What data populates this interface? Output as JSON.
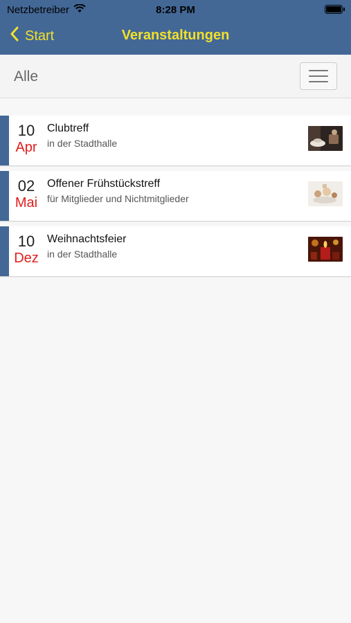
{
  "status": {
    "carrier": "Netzbetreiber",
    "time": "8:28 PM"
  },
  "nav": {
    "back_label": "Start",
    "title": "Veranstaltungen"
  },
  "filter": {
    "label": "Alle"
  },
  "events": [
    {
      "day": "10",
      "month": "Apr",
      "title": "Clubtreff",
      "subtitle": "in der Stadthalle"
    },
    {
      "day": "02",
      "month": "Mai",
      "title": "Offener Frühstückstreff",
      "subtitle": "für Mitglieder und Nichtmitglieder"
    },
    {
      "day": "10",
      "month": "Dez",
      "title": "Weihnachtsfeier",
      "subtitle": "in der Stadthalle"
    }
  ],
  "colors": {
    "header": "#436896",
    "accent": "#f2e02b",
    "month": "#e01d1d"
  }
}
